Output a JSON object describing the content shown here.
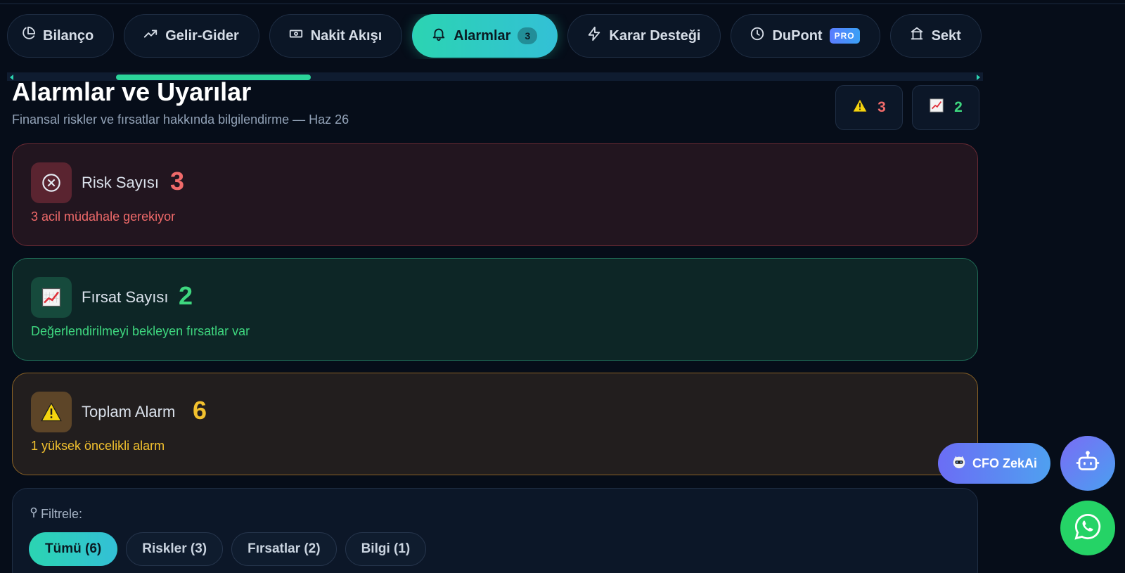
{
  "tabs": [
    {
      "label": "Bilanço",
      "icon": "pie-chart-icon"
    },
    {
      "label": "Gelir-Gider",
      "icon": "trending-up-icon"
    },
    {
      "label": "Nakit Akışı",
      "icon": "banknote-icon"
    },
    {
      "label": "Alarmlar",
      "icon": "bell-icon",
      "badge": "3",
      "active": true
    },
    {
      "label": "Karar Desteği",
      "icon": "zap-icon"
    },
    {
      "label": "DuPont",
      "icon": "clock-icon",
      "badge": "PRO"
    },
    {
      "label": "Sekt",
      "icon": "bank-icon"
    }
  ],
  "header": {
    "title": "Alarmlar ve Uyarılar",
    "subtitle": "Finansal riskler ve fırsatlar hakkında bilgilendirme — Haz 26",
    "risk_count": "3",
    "opportunity_count": "2"
  },
  "cards": {
    "risk": {
      "label": "Risk Sayısı",
      "value": "3",
      "note": "3 acil müdahale gerekiyor",
      "icon": "x-circle-icon"
    },
    "opportunity": {
      "label": "Fırsat Sayısı",
      "value": "2",
      "note": "Değerlendirilmeyi bekleyen fırsatlar var",
      "icon": "chart-increasing-icon"
    },
    "total": {
      "label": "Toplam Alarm",
      "value": "6",
      "note": "1 yüksek öncelikli alarm",
      "icon": "warning-icon"
    }
  },
  "filter": {
    "label": "Filtrele:",
    "buttons": [
      "Tümü (6)",
      "Riskler (3)",
      "Fırsatlar (2)",
      "Bilgi (1)"
    ],
    "active": "Tümü (6)"
  },
  "floating": {
    "cfo_label": "CFO ZekAi"
  },
  "colors": {
    "accent": "#2bd4b2",
    "risk": "#f06a6a",
    "opportunity": "#3ed77f",
    "warning": "#f2c12e",
    "background": "#060d19"
  },
  "scroll": {
    "thumb_fraction": 0.2
  }
}
